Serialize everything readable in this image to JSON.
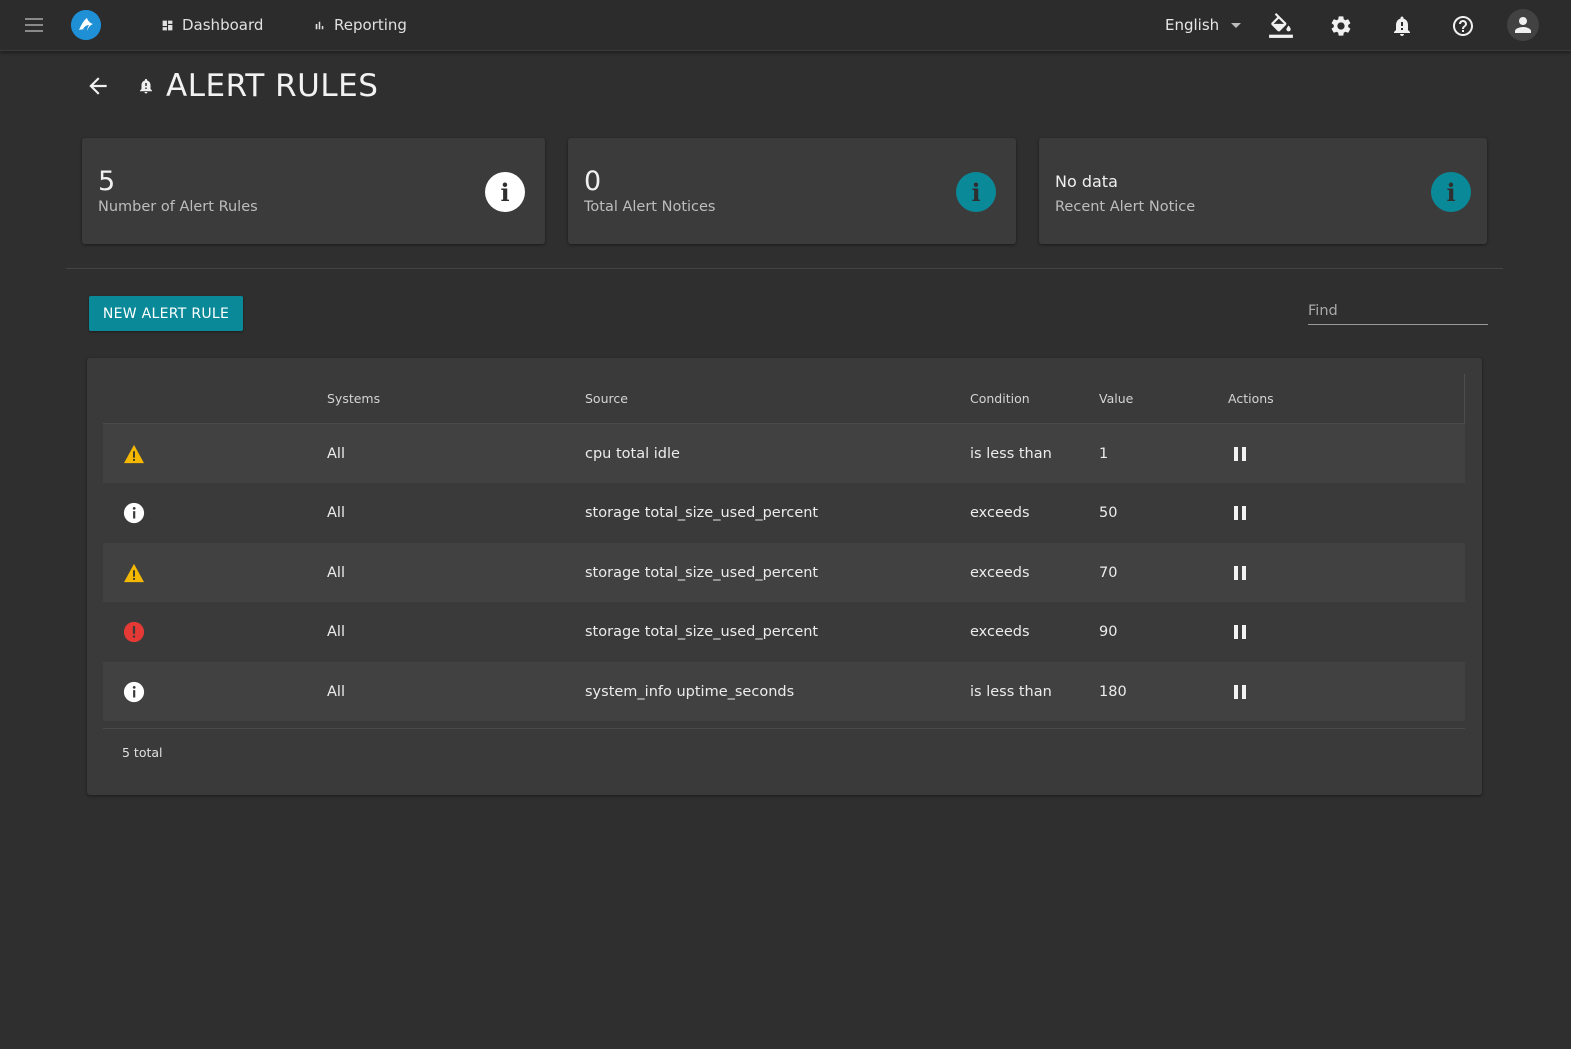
{
  "nav": {
    "dashboard_label": "Dashboard",
    "reporting_label": "Reporting",
    "language": "English"
  },
  "page": {
    "title": "ALERT RULES"
  },
  "cards": [
    {
      "value": "5",
      "label": "Number of Alert Rules",
      "icon_color": "#ffffff"
    },
    {
      "value": "0",
      "label": "Total Alert Notices",
      "icon_color": "#0a8a99"
    },
    {
      "value": "No data",
      "label": "Recent Alert Notice",
      "icon_color": "#0a8a99"
    }
  ],
  "toolbar": {
    "new_button_label": "NEW ALERT RULE",
    "find_placeholder": "Find"
  },
  "table": {
    "columns": [
      "",
      "Systems",
      "Source",
      "Condition",
      "Value",
      "Actions"
    ],
    "rows": [
      {
        "severity": "warning-icon",
        "systems": "All",
        "source": "cpu total idle",
        "condition": "is less than",
        "value": "1"
      },
      {
        "severity": "info-icon",
        "systems": "All",
        "source": "storage total_size_used_percent",
        "condition": "exceeds",
        "value": "50"
      },
      {
        "severity": "warning-icon",
        "systems": "All",
        "source": "storage total_size_used_percent",
        "condition": "exceeds",
        "value": "70"
      },
      {
        "severity": "error-icon",
        "systems": "All",
        "source": "storage total_size_used_percent",
        "condition": "exceeds",
        "value": "90"
      },
      {
        "severity": "info-icon",
        "systems": "All",
        "source": "system_info uptime_seconds",
        "condition": "is less than",
        "value": "180"
      }
    ],
    "total_label": "5 total"
  },
  "colors": {
    "accent": "#0a8a99",
    "warning": "#f5b800",
    "error": "#e53935",
    "background": "#2f2f2f"
  }
}
